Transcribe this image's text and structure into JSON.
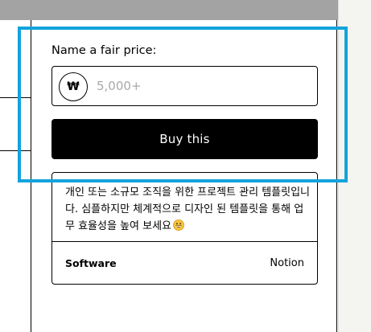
{
  "pricing": {
    "label": "Name a fair price:",
    "currency_symbol": "₩",
    "placeholder": "5,000+"
  },
  "buy_button": {
    "label": "Buy this"
  },
  "description": {
    "text": "개인 또는 소규모 조직을 위한 프로젝트 관리 템플릿입니다. 심플하지만 체계적으로 디자인 된 템플릿을 통해 업무 효율성을 높여 보세요",
    "emoji_icon": "grinning-face-icon"
  },
  "specs": [
    {
      "key": "Software",
      "value": "Notion"
    }
  ],
  "colors": {
    "top_bar": "#a3a3a3",
    "highlight": "#12a3dc",
    "button": "#000000",
    "right_panel": "#f4f4f0"
  }
}
